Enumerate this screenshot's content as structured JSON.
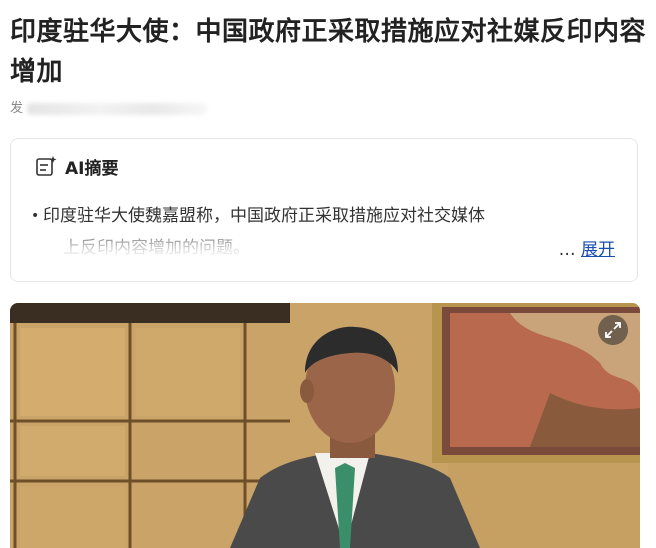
{
  "article": {
    "title": "印度驻华大使：中国政府正采取措施应对社媒反印内容增加",
    "meta_prefix": "发"
  },
  "ai_summary": {
    "icon": "ai-summary-icon",
    "title": "AI摘要",
    "text_line1": "印度驻华大使魏嘉盟称，中国政府正采取措施应对社交媒体",
    "text_line2": "上反印内容增加的问题。",
    "ellipsis": "…",
    "expand_label": "展开"
  },
  "photo": {
    "icon": "expand-icon",
    "description_colors": {
      "wall": "#caa66a",
      "suit": "#4a4a4a",
      "tie": "#3a8f6a"
    }
  }
}
